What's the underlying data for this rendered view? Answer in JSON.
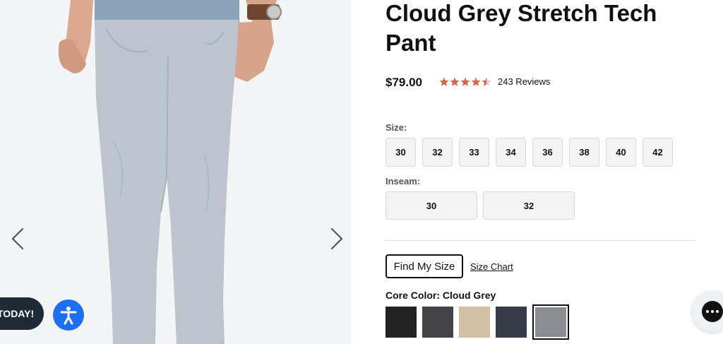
{
  "product": {
    "title": "Cloud Grey Stretch Tech Pant",
    "price": "$79.00",
    "rating": 4.5,
    "rating_out_of": 5,
    "reviews_label": "243 Reviews"
  },
  "size": {
    "label": "Size:",
    "options": [
      "30",
      "32",
      "33",
      "34",
      "36",
      "38",
      "40",
      "42"
    ]
  },
  "inseam": {
    "label": "Inseam:",
    "options": [
      "30",
      "32"
    ]
  },
  "find_my_size_label": "Find My Size",
  "size_chart_label": "Size Chart",
  "color": {
    "label": "Core Color: Cloud Grey",
    "swatches": [
      {
        "name": "black",
        "hex": "#232323"
      },
      {
        "name": "charcoal",
        "hex": "#444446"
      },
      {
        "name": "khaki",
        "hex": "#d2bfa5"
      },
      {
        "name": "navy",
        "hex": "#363b48"
      },
      {
        "name": "cloud-grey",
        "hex": "#8c8d92",
        "selected": true
      }
    ]
  },
  "promo_label": "TODAY!",
  "colors": {
    "star": "#e0604d",
    "accessibility_button": "#1d6ff2",
    "promo_pill": "#1f2a37"
  },
  "icons": {
    "gallery_prev": "chevron-left-icon",
    "gallery_next": "chevron-right-icon",
    "accessibility": "accessibility-icon",
    "chat": "chat-icon",
    "star": "star-icon"
  }
}
